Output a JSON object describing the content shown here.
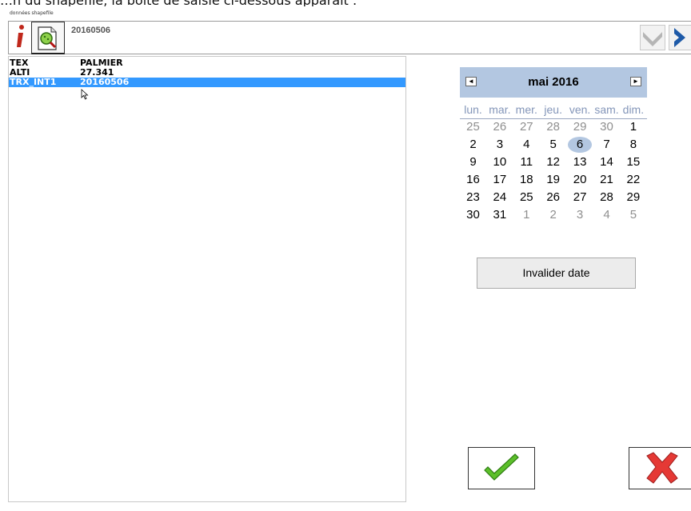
{
  "caption": "…n du shapefile, la boîte de saisie ci-dessous apparaît :",
  "window_title": "données shapefile",
  "toolbar": {
    "current_value": "20160506"
  },
  "list": {
    "rows": [
      {
        "key": "TEX",
        "value": "PALMIER"
      },
      {
        "key": "ALTI",
        "value": "27.341"
      },
      {
        "key": "TRX_INT1",
        "value": "20160506"
      }
    ]
  },
  "calendar": {
    "title": "mai 2016",
    "prev_label": "◄",
    "next_label": "►",
    "weekdays": [
      "lun.",
      "mar.",
      "mer.",
      "jeu.",
      "ven.",
      "sam.",
      "dim."
    ],
    "weeks": [
      [
        "25",
        "26",
        "27",
        "28",
        "29",
        "30",
        "1"
      ],
      [
        "2",
        "3",
        "4",
        "5",
        "6",
        "7",
        "8"
      ],
      [
        "9",
        "10",
        "11",
        "12",
        "13",
        "14",
        "15"
      ],
      [
        "16",
        "17",
        "18",
        "19",
        "20",
        "21",
        "22"
      ],
      [
        "23",
        "24",
        "25",
        "26",
        "27",
        "28",
        "29"
      ],
      [
        "30",
        "31",
        "1",
        "2",
        "3",
        "4",
        "5"
      ]
    ],
    "selected_day": "6"
  },
  "buttons": {
    "invalidate_label": "Invalider date"
  },
  "colors": {
    "selection": "#3399ff",
    "calendar_header": "#b3c7e1",
    "ok": "#4caf2a",
    "cancel": "#e53935"
  }
}
